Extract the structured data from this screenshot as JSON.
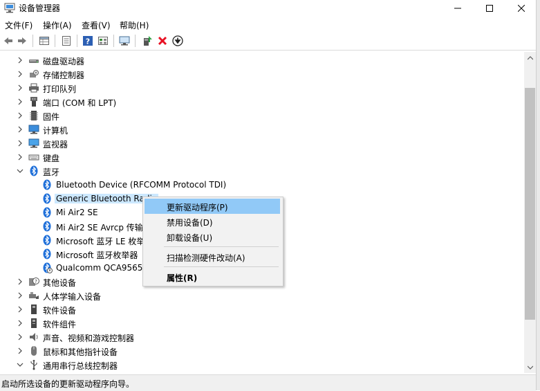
{
  "window": {
    "title": "设备管理器",
    "min": "—",
    "max": "☐",
    "close": "✕"
  },
  "menu": [
    "文件(F)",
    "操作(A)",
    "查看(V)",
    "帮助(H)"
  ],
  "toolbar_icons": [
    "back-arrow-icon",
    "forward-arrow-icon",
    "properties-grid-icon",
    "details-icon",
    "help-icon",
    "view-icon",
    "monitor-icon",
    "update-driver-icon",
    "remove-device-icon",
    "download-icon"
  ],
  "tree": [
    {
      "label": "磁盘驱动器",
      "icon": "disk-drive-icon",
      "expanded": false,
      "level": 0
    },
    {
      "label": "存储控制器",
      "icon": "storage-controller-icon",
      "expanded": false,
      "level": 0
    },
    {
      "label": "打印队列",
      "icon": "printer-icon",
      "expanded": false,
      "level": 0
    },
    {
      "label": "端口 (COM 和 LPT)",
      "icon": "port-icon",
      "expanded": false,
      "level": 0
    },
    {
      "label": "固件",
      "icon": "firmware-icon",
      "expanded": false,
      "level": 0
    },
    {
      "label": "计算机",
      "icon": "computer-icon",
      "expanded": false,
      "level": 0
    },
    {
      "label": "监视器",
      "icon": "monitor-icon",
      "expanded": false,
      "level": 0
    },
    {
      "label": "键盘",
      "icon": "keyboard-icon",
      "expanded": false,
      "level": 0
    },
    {
      "label": "蓝牙",
      "icon": "bluetooth-icon",
      "expanded": true,
      "level": 0
    },
    {
      "label": "Bluetooth Device (RFCOMM Protocol TDI)",
      "icon": "bluetooth-icon",
      "level": 1
    },
    {
      "label": "Generic Bluetooth Radio",
      "icon": "bluetooth-icon",
      "level": 1,
      "selected": true
    },
    {
      "label": "Mi Air2 SE",
      "icon": "bluetooth-icon",
      "level": 1
    },
    {
      "label": "Mi Air2 SE Avrcp 传输",
      "icon": "bluetooth-icon",
      "level": 1
    },
    {
      "label": "Microsoft 蓝牙 LE 枚举器",
      "icon": "bluetooth-icon",
      "level": 1
    },
    {
      "label": "Microsoft 蓝牙枚举器",
      "icon": "bluetooth-icon",
      "level": 1
    },
    {
      "label": "Qualcomm QCA9565",
      "icon": "bluetooth-warning-icon",
      "level": 1
    },
    {
      "label": "其他设备",
      "icon": "unknown-device-icon",
      "expanded": false,
      "level": 0
    },
    {
      "label": "人体学输入设备",
      "icon": "hid-icon",
      "expanded": false,
      "level": 0
    },
    {
      "label": "软件设备",
      "icon": "software-device-icon",
      "expanded": false,
      "level": 0
    },
    {
      "label": "软件组件",
      "icon": "software-component-icon",
      "expanded": false,
      "level": 0
    },
    {
      "label": "声音、视频和游戏控制器",
      "icon": "speaker-icon",
      "expanded": false,
      "level": 0
    },
    {
      "label": "鼠标和其他指针设备",
      "icon": "mouse-icon",
      "expanded": false,
      "level": 0
    },
    {
      "label": "通用串行总线控制器",
      "icon": "usb-icon",
      "expanded": true,
      "level": 0
    }
  ],
  "context_menu": [
    {
      "label": "更新驱动程序(P)",
      "highlighted": true
    },
    {
      "label": "禁用设备(D)"
    },
    {
      "label": "卸载设备(U)"
    },
    {
      "separator": true
    },
    {
      "label": "扫描检测硬件改动(A)"
    },
    {
      "separator": true
    },
    {
      "label": "属性(R)",
      "bold": true
    }
  ],
  "status": "启动所选设备的更新驱动程序向导。",
  "colors": {
    "selection": "#cce8ff",
    "menu_highlight": "#91c9f7",
    "bluetooth": "#1e6fd9",
    "remove": "#e81123"
  }
}
